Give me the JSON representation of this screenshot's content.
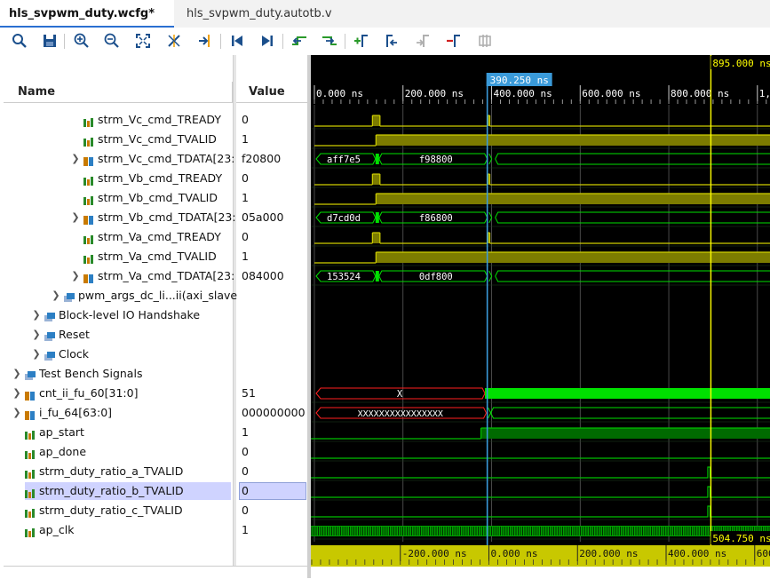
{
  "tabs": [
    {
      "label": "hls_svpwm_duty.wcfg*",
      "active": true
    },
    {
      "label": "hls_svpwm_duty.autotb.v",
      "active": false
    }
  ],
  "tab_close_glyph": "✕",
  "toolbar": {
    "icons": [
      "search-icon",
      "save-icon",
      "zoom-in-icon",
      "zoom-out-icon",
      "zoom-fit-icon",
      "zoom-cursor-icon",
      "go-to-cursor-icon",
      "go-to-start-icon",
      "go-to-end-icon",
      "previous-transition-icon",
      "next-transition-icon",
      "add-marker-icon",
      "previous-marker-icon",
      "next-marker-icon",
      "delete-marker-icon",
      "swap-cursors-icon"
    ]
  },
  "columns": {
    "name": "Name",
    "value": "Value"
  },
  "signals": [
    {
      "name": "strm_Vc_cmd_TREADY",
      "value": "0",
      "indent": 3,
      "kind": "bit",
      "expandable": false
    },
    {
      "name": "strm_Vc_cmd_TVALID",
      "value": "1",
      "indent": 3,
      "kind": "bit",
      "expandable": false
    },
    {
      "name": "strm_Vc_cmd_TDATA[23:",
      "value": "f20800",
      "indent": 3,
      "kind": "bus",
      "expandable": true
    },
    {
      "name": "strm_Vb_cmd_TREADY",
      "value": "0",
      "indent": 3,
      "kind": "bit",
      "expandable": false
    },
    {
      "name": "strm_Vb_cmd_TVALID",
      "value": "1",
      "indent": 3,
      "kind": "bit",
      "expandable": false
    },
    {
      "name": "strm_Vb_cmd_TDATA[23:",
      "value": "05a000",
      "indent": 3,
      "kind": "bus",
      "expandable": true
    },
    {
      "name": "strm_Va_cmd_TREADY",
      "value": "0",
      "indent": 3,
      "kind": "bit",
      "expandable": false
    },
    {
      "name": "strm_Va_cmd_TVALID",
      "value": "1",
      "indent": 3,
      "kind": "bit",
      "expandable": false
    },
    {
      "name": "strm_Va_cmd_TDATA[23:",
      "value": "084000",
      "indent": 3,
      "kind": "bus",
      "expandable": true
    },
    {
      "name": "pwm_args_dc_li...ii(axi_slave",
      "value": "",
      "indent": 2,
      "kind": "group",
      "expandable": true
    },
    {
      "name": "Block-level IO Handshake",
      "value": "",
      "indent": 1,
      "kind": "group",
      "expandable": true
    },
    {
      "name": "Reset",
      "value": "",
      "indent": 1,
      "kind": "group",
      "expandable": true
    },
    {
      "name": "Clock",
      "value": "",
      "indent": 1,
      "kind": "group",
      "expandable": true
    },
    {
      "name": "Test Bench Signals",
      "value": "",
      "indent": 0,
      "kind": "group",
      "expandable": true
    },
    {
      "name": "cnt_ii_fu_60[31:0]",
      "value": "51",
      "indent": 0,
      "kind": "bus",
      "expandable": true
    },
    {
      "name": "i_fu_64[63:0]",
      "value": "000000000",
      "indent": 0,
      "kind": "bus",
      "expandable": true
    },
    {
      "name": "ap_start",
      "value": "1",
      "indent": 0,
      "kind": "bit",
      "expandable": false
    },
    {
      "name": "ap_done",
      "value": "0",
      "indent": 0,
      "kind": "bit",
      "expandable": false
    },
    {
      "name": "strm_duty_ratio_a_TVALID",
      "value": "0",
      "indent": 0,
      "kind": "bit",
      "expandable": false
    },
    {
      "name": "strm_duty_ratio_b_TVALID",
      "value": "0",
      "indent": 0,
      "kind": "bit",
      "expandable": false,
      "selected": true
    },
    {
      "name": "strm_duty_ratio_c_TVALID",
      "value": "0",
      "indent": 0,
      "kind": "bit",
      "expandable": false
    },
    {
      "name": "ap_clk",
      "value": "1",
      "indent": 0,
      "kind": "bit",
      "expandable": false
    }
  ],
  "timeline": {
    "top_ticks": [
      {
        "label": "0.000 ns",
        "t": 0
      },
      {
        "label": "200.000 ns",
        "t": 200
      },
      {
        "label": "400.000 ns",
        "t": 400
      },
      {
        "label": "600.000 ns",
        "t": 600
      },
      {
        "label": "800.000 ns",
        "t": 800
      },
      {
        "label": "1,",
        "t": 1000
      }
    ],
    "bottom_ticks": [
      {
        "label": "-200.000 ns",
        "t": -200
      },
      {
        "label": "0.000 ns",
        "t": 0
      },
      {
        "label": "200.000 ns",
        "t": 200
      },
      {
        "label": "400.000 ns",
        "t": 400
      },
      {
        "label": "600",
        "t": 600
      }
    ],
    "cursor_time": "390.250 ns",
    "cursor_ns": 390.25,
    "marker_time": "895.000 ns",
    "marker_ns": 895,
    "delta_time": "504.750 ns"
  },
  "buses": {
    "vc_tdata": {
      "before": "aff7e5",
      "after": "f98800"
    },
    "vb_tdata": {
      "before": "d7cd0d",
      "after": "f86800"
    },
    "va_tdata": {
      "before": "153524",
      "after": "0df800"
    },
    "cnt_ii": {
      "before": "X"
    },
    "i_fu": {
      "before": "XXXXXXXXXXXXXXXX"
    }
  },
  "colors": {
    "bit_high": "#cfcf00",
    "bit_fill": "#7c7c00",
    "bus": "#00e000",
    "unknown": "#ff2020",
    "cursor": "#3a9ad9",
    "marker": "#ffff00",
    "grid": "#5a5a5a",
    "group": "#00d000"
  }
}
